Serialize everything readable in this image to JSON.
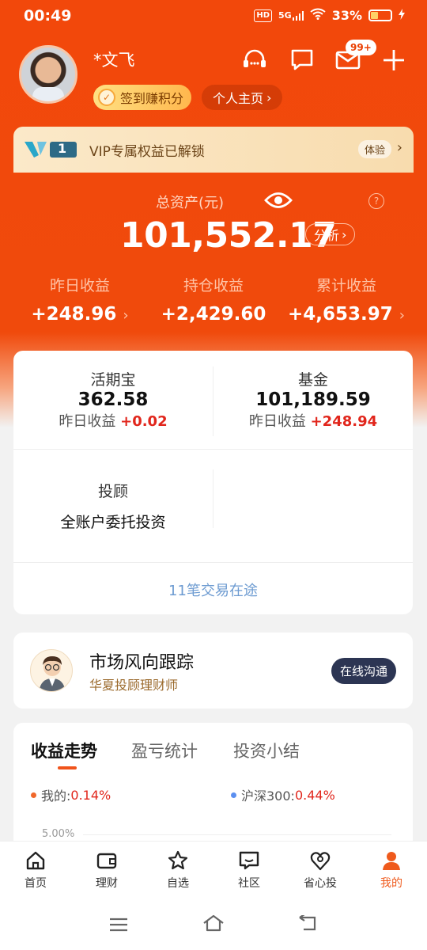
{
  "status": {
    "time": "00:49",
    "hd": "HD",
    "network": "5G",
    "battery": "33%"
  },
  "profile": {
    "name": "*文飞",
    "sign_label": "签到赚积分",
    "home_label": "个人主页",
    "chevron": "›"
  },
  "header_icons": {
    "service": "headset-icon",
    "message": "chat-bubble-icon",
    "mail": "mail-icon",
    "mail_badge": "99+",
    "add": "plus-icon"
  },
  "vip": {
    "badge": "1",
    "text": "VIP专属权益已解锁",
    "try_label": "体验",
    "chevron": "›"
  },
  "assets": {
    "label": "总资产(元)",
    "question": "?",
    "total": "101,552.17",
    "analysis_label": "分析",
    "chevron": "›"
  },
  "stats": [
    {
      "label": "昨日收益",
      "value": "+248.96",
      "chevron": "›"
    },
    {
      "label": "持仓收益",
      "value": "+2,429.60",
      "chevron": ""
    },
    {
      "label": "累计收益",
      "value": "+4,653.97",
      "chevron": "›"
    }
  ],
  "products": {
    "huoqibao": {
      "title": "活期宝",
      "amount": "362.58",
      "sub_label": "昨日收益",
      "sub_value": "+0.02"
    },
    "fund": {
      "title": "基金",
      "amount": "101,189.59",
      "sub_label": "昨日收益",
      "sub_value": "+248.94"
    },
    "advisor": {
      "title": "投顾",
      "desc": "全账户委托投资"
    },
    "transit": "11笔交易在途"
  },
  "advisor_card": {
    "title": "市场风向跟踪",
    "subtitle": "华夏投顾理财师",
    "button": "在线沟通"
  },
  "trend": {
    "tabs": [
      "收益走势",
      "盈亏统计",
      "投资小结"
    ],
    "legend_mine_label": "我的:",
    "legend_mine_value": "0.14%",
    "legend_index_label": "沪深300:",
    "legend_index_value": "0.44%",
    "y_tick": "5.00%",
    "colors": {
      "mine": "#f0672a",
      "index": "#5b8ff0"
    }
  },
  "tabbar": [
    {
      "label": "首页",
      "icon": "home-icon"
    },
    {
      "label": "理财",
      "icon": "wallet-icon"
    },
    {
      "label": "自选",
      "icon": "star-icon"
    },
    {
      "label": "社区",
      "icon": "community-chat-icon"
    },
    {
      "label": "省心投",
      "icon": "heart-location-icon"
    },
    {
      "label": "我的",
      "icon": "person-icon"
    }
  ],
  "colors": {
    "brand": "#f2480b",
    "accent_red": "#e1261c",
    "active_tab": "#ef5a1c"
  }
}
